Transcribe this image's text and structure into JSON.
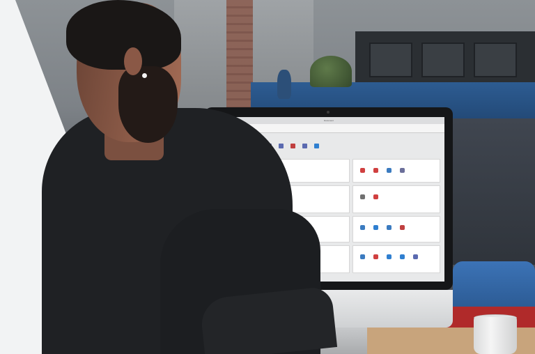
{
  "scene": {
    "description_colors": {
      "panel": "#f2f3f4",
      "shelf": "#2d5c92",
      "monitor_bezel": "#151618"
    }
  },
  "app": {
    "window_title": "Document",
    "ribbon_label": "",
    "home_button": "",
    "toolbar": [
      {
        "icon": "document-icon",
        "color": "#7a7fb0"
      },
      {
        "icon": "calendar-icon",
        "color": "#c0403a"
      },
      {
        "icon": "tool-icon",
        "color": "#6b6f9a"
      },
      {
        "icon": "user-icon",
        "color": "#3b7bc0"
      },
      {
        "icon": "pointer-icon",
        "color": "#6b6f9a"
      },
      {
        "icon": "chart-icon",
        "color": "#5b6ab0"
      },
      {
        "icon": "report-icon",
        "color": "#c04040"
      },
      {
        "icon": "chart-icon",
        "color": "#5b6ab0"
      },
      {
        "icon": "globe-icon",
        "color": "#2f7fd0"
      }
    ],
    "groups": [
      {
        "id": "g1",
        "icons": [
          {
            "icon": "gauge-icon",
            "color": "#d04040"
          },
          {
            "icon": "report-icon",
            "color": "#b05050"
          },
          {
            "icon": "tool-icon",
            "color": "#707070"
          },
          {
            "icon": "wrench-icon",
            "color": "#2f7fd0"
          }
        ]
      },
      {
        "id": "g2",
        "icons": [
          {
            "icon": "filter-icon",
            "color": "#6b6f9a"
          },
          {
            "icon": "globe-icon",
            "color": "#2f7fd0"
          },
          {
            "icon": "doc-icon",
            "color": "#c04040"
          },
          {
            "icon": "box-icon",
            "color": "#3b7bc0"
          },
          {
            "icon": "building-icon",
            "color": "#d04040"
          }
        ]
      },
      {
        "id": "g3",
        "icons": [
          {
            "icon": "calendar-icon",
            "color": "#c0403a"
          },
          {
            "icon": "calendar-icon",
            "color": "#5b6ab0"
          }
        ]
      },
      {
        "id": "g4",
        "icons": [
          {
            "icon": "chart-icon",
            "color": "#5b6ab0"
          },
          {
            "icon": "chart-icon",
            "color": "#5b6ab0"
          },
          {
            "icon": "chart-icon",
            "color": "#5b6ab0"
          },
          {
            "icon": "chart-icon",
            "color": "#5b6ab0"
          },
          {
            "icon": "chart-icon",
            "color": "#5b6ab0"
          },
          {
            "icon": "chart-icon",
            "color": "#5b6ab0"
          },
          {
            "icon": "chart-icon",
            "color": "#5b6ab0"
          }
        ]
      },
      {
        "id": "g5",
        "icons": [
          {
            "icon": "user-icon",
            "color": "#d04040"
          },
          {
            "icon": "heart-icon",
            "color": "#d04040"
          },
          {
            "icon": "user-icon",
            "color": "#3b7bc0"
          },
          {
            "icon": "pointer-icon",
            "color": "#6b6f9a"
          }
        ]
      },
      {
        "id": "g6",
        "icons": [
          {
            "icon": "tool-icon",
            "color": "#707070"
          },
          {
            "icon": "heart-icon",
            "color": "#d04040"
          }
        ]
      },
      {
        "id": "g7",
        "icons": [
          {
            "icon": "user-icon",
            "color": "#3b7bc0"
          },
          {
            "icon": "globe-icon",
            "color": "#2f7fd0"
          },
          {
            "icon": "user-icon",
            "color": "#3b7bc0"
          },
          {
            "icon": "chart-icon",
            "color": "#c04040"
          }
        ]
      },
      {
        "id": "g8",
        "icons": [
          {
            "icon": "user-icon",
            "color": "#3b7bc0"
          },
          {
            "icon": "user-icon",
            "color": "#d04040"
          },
          {
            "icon": "globe-icon",
            "color": "#2f7fd0"
          },
          {
            "icon": "globe-icon",
            "color": "#2f7fd0"
          },
          {
            "icon": "doc-icon",
            "color": "#5b6ab0"
          }
        ]
      }
    ]
  }
}
